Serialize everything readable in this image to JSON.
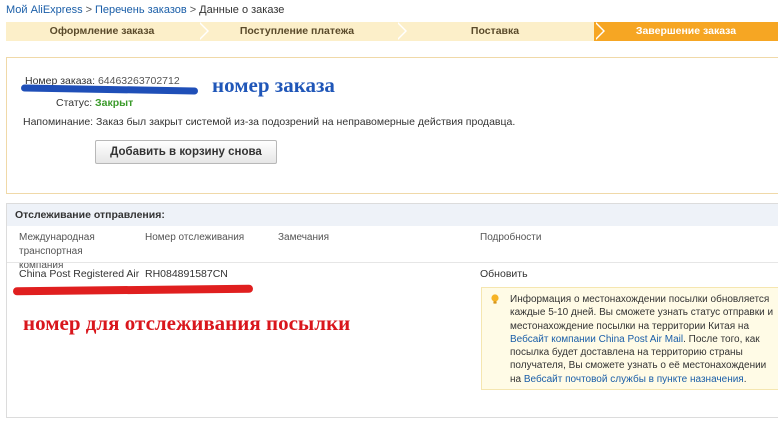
{
  "breadcrumb": {
    "items": [
      "Мой AliExpress",
      "Перечень заказов",
      "Данные о заказе"
    ],
    "separator": ">"
  },
  "steps": [
    {
      "label": "Оформление заказа",
      "active": false
    },
    {
      "label": "Поступление платежа",
      "active": false
    },
    {
      "label": "Поставка",
      "active": false
    },
    {
      "label": "Завершение заказа",
      "active": true
    }
  ],
  "order": {
    "number_label": "Номер заказа:",
    "number_value": "64463263702712",
    "status_label": "Статус:",
    "status_value": "Закрыт",
    "reminder_label": "Напоминание:",
    "reminder_value": "Заказ был закрыт системой из-за подозрений на неправомерные действия продавца.",
    "add_to_cart_button": "Добавить в корзину снова"
  },
  "annotations": {
    "order_number": "номер заказа",
    "tracking_number": "номер для отслеживания посылки"
  },
  "tracking": {
    "title": "Отслеживание отправления:",
    "columns": [
      "Международная транспортная компания",
      "Номер отслеживания",
      "Замечания",
      "Подробности"
    ],
    "row": {
      "carrier": "China Post Registered Air",
      "tracking_number": "RH084891587CN",
      "remarks": "",
      "details_link": "Обновить"
    },
    "info": {
      "text_1": "Информация о местонахождении посылки обновляется каждые 5-10 дней. Вы сможете узнать статус отправки и местонахождение посылки на территории Китая на ",
      "link_1": "Вебсайт компании China Post Air Mail",
      "text_2": ". После того, как посылка будет доставлена на территорию страны получателя, Вы сможете узнать о её местонахождении на ",
      "link_2": "Вебсайт почтовой службы в пункте назначения",
      "text_3": "."
    }
  },
  "colors": {
    "active_step": "#f6a623",
    "inactive_step": "#fcefc9",
    "link": "#1a5ea8",
    "status_closed": "#3a9a2a",
    "annotation_blue": "#1f56b8",
    "annotation_red": "#d9161c"
  },
  "icons": {
    "info": "lightbulb-icon"
  }
}
